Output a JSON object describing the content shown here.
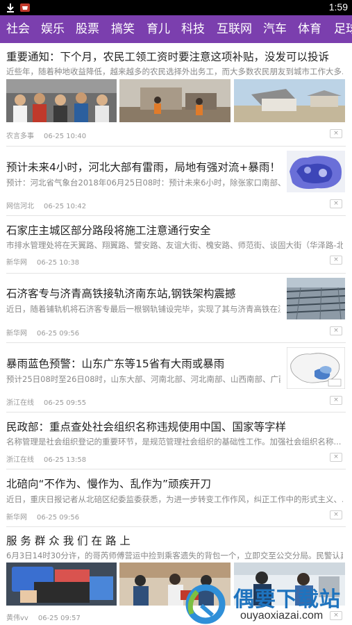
{
  "status_bar": {
    "time": "1:59",
    "icons": [
      "download-icon",
      "shopping-bag-icon"
    ]
  },
  "tabs": [
    "社会",
    "娱乐",
    "股票",
    "搞笑",
    "育儿",
    "科技",
    "互联网",
    "汽车",
    "体育",
    "足球"
  ],
  "close_label": "×",
  "articles": [
    {
      "title": "重要通知：下个月，农民工领工资时要注意这项补贴，没发可以投诉",
      "summary": "近些年，随着种地收益降低，越来越多的农民选择外出务工，而大多数农民朋友到城市工作大多...",
      "source": "农言多事",
      "date": "06-25 10:40"
    },
    {
      "title": "预计未来4小时，河北大部有雷雨，局地有强对流+暴雨！",
      "summary": "预计：河北省气象台2018年06月25日08时：预计未来6小时，除张家口南部、...",
      "source": "网信河北",
      "date": "06-25 10:42"
    },
    {
      "title": "石家庄主城区部分路段将施工注意通行安全",
      "summary": "市排水管理处将在天翼路、翔翼路、譬安路、友谊大街、槐安路、师范街、谈固大街（华泽路-北...",
      "source": "新华网",
      "date": "06-25 10:38"
    },
    {
      "title": "石济客专与济青高铁接轨济南东站,钢铁架构震撼",
      "summary": "近日，随着铺轨机将石济客专最后一根钢轨铺设完毕，实现了其与济青高铁在济...",
      "source": "新华网",
      "date": "06-25 09:56"
    },
    {
      "title": "暴雨蓝色预警：山东广东等15省有大雨或暴雨",
      "summary": "预计25日08时至26日08时，山东大部、河南北部、河北南部、山西南部、广西...",
      "source": "浙江在线",
      "date": "06-25 09:55"
    },
    {
      "title": "民政部：重点查处社会组织名称违规使用中国、国家等字样",
      "summary": "名称管理是社会组织登记的重要环节，是规范管理社会组织的基础性工作。加强社会组织名称...",
      "source": "浙江在线",
      "date": "06-25 13:58"
    },
    {
      "title": "北碚向“不作为、慢作为、乱作为”顽疾开刀",
      "summary": "近日，重庆日报记者从北碚区纪委监委获悉，为进一步转变工作作风，纠正工作中的形式主义、...",
      "source": "新华网",
      "date": "06-25 09:56"
    },
    {
      "title": "服 务 群 众  我 们 在 路 上",
      "summary": "6月3日14时30分许，的哥芮师傅营运中捡到乘客遗失的背包一个，立即交至公交分局。民警认真...",
      "source": "黄伟vv",
      "date": "06-25 09:57"
    }
  ],
  "watermark": {
    "cn": "偶要下载站",
    "en": "ouyaoxiazai.com"
  }
}
